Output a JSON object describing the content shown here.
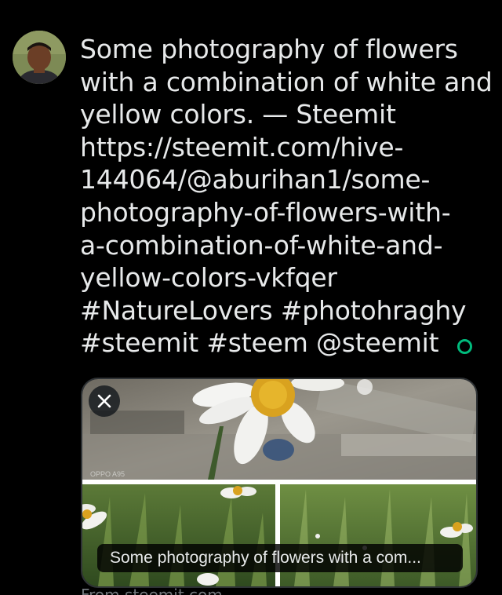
{
  "tweet": {
    "lines": [
      "Some photography of flowers",
      "with a combination of white and",
      "yellow colors. — Steemit",
      "https://steemit.com/hive-",
      "144064/@aburihan1/some-",
      "photography-of-flowers-with-",
      "a-combination-of-white-and-",
      "yellow-colors-vkfqer",
      "#NatureLovers #photohraghy",
      "#steemit #steem @steemit"
    ]
  },
  "card": {
    "watermark": "OPPO A95",
    "caption": "Some photography of flowers with a com...",
    "from_label": "From steemit.com"
  },
  "icons": {
    "close": "close-icon",
    "status": "status-dot-icon",
    "avatar": "avatar"
  },
  "colors": {
    "background": "#000000",
    "text": "#e7e9ea",
    "muted": "#71767b",
    "status_green": "#00ba7c",
    "card_border": "#2f3336"
  }
}
